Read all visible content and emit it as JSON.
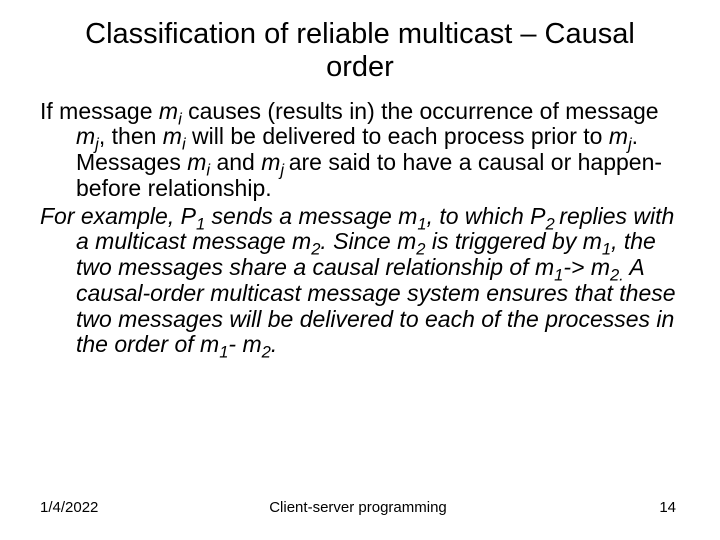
{
  "title": "Classification of reliable multicast – Causal order",
  "para1": {
    "t1": "If message ",
    "mi": "m",
    "mi_sub": "i",
    "t2": " causes  (results in) the occurrence of message ",
    "mj": "m",
    "mj_sub": "j",
    "t3": ", then ",
    "mi2": "m",
    "mi2_sub": "i",
    "t4": " will be delivered to each process prior to ",
    "mj2": "m",
    "mj2_sub": "j",
    "t5": ".  Messages ",
    "mi3": "m",
    "mi3_sub": "i",
    "t6": " and ",
    "mj3": "m",
    "mj3_sub": "j ",
    "t7": " are said to have a causal or happen-before relationship."
  },
  "para2": {
    "t0": "For example, P",
    "p1_sub": "1",
    "t1": " sends a message m",
    "m1a_sub": "1",
    "t2": ", to which P",
    "p2_sub": "2 ",
    "t3": "replies with a multicast message m",
    "m2a_sub": "2",
    "t4": ".   Since m",
    "m2b_sub": "2",
    "t5": " is triggered by m",
    "m1b_sub": "1",
    "t6": ", the two messages share a causal relationship of m",
    "m1c_sub": "1",
    "t7": "-> m",
    "m2c_sub": "2.",
    "t8": " A causal-order multicast message system ensures that these two messages will be delivered to each of the processes in the order of m",
    "m1d_sub": "1",
    "t9": "- m",
    "m2d_sub": "2",
    "t10": "."
  },
  "footer": {
    "date": "1/4/2022",
    "center": "Client-server programming",
    "page": "14"
  }
}
